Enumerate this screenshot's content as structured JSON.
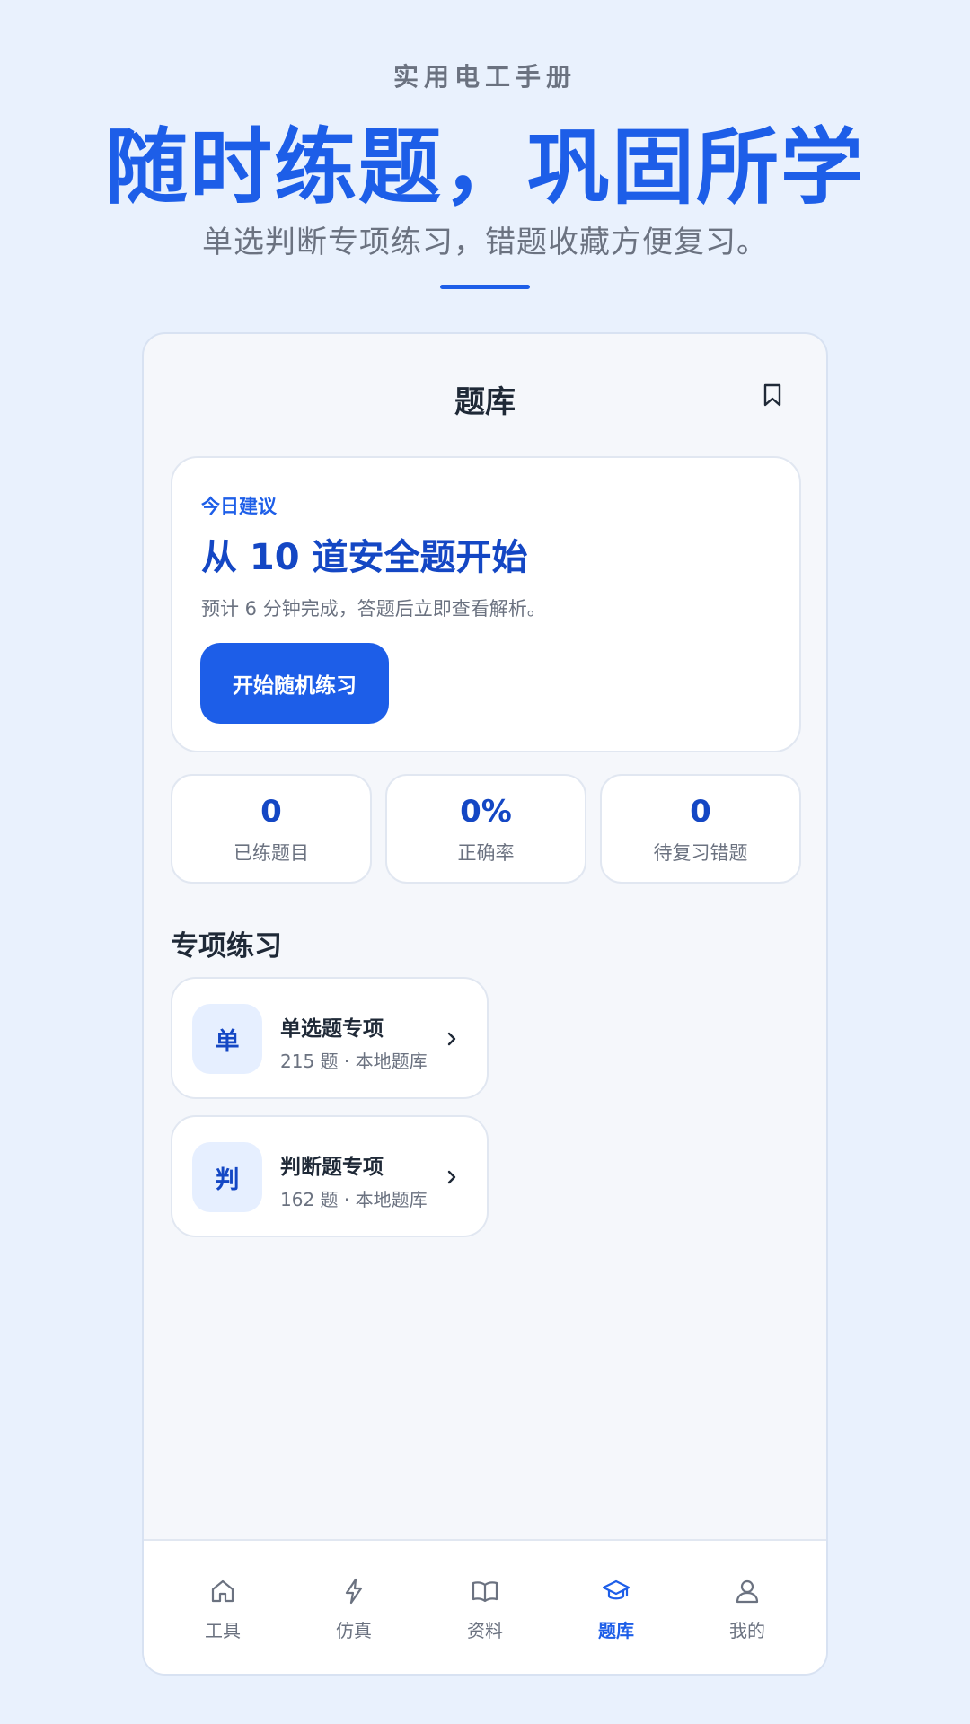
{
  "promo": {
    "app_name": "实用电工手册",
    "headline": "随时练题，巩固所学",
    "subhead": "单选判断专项练习，错题收藏方便复习。"
  },
  "topbar": {
    "title": "题库",
    "bookmark_icon": "bookmark-icon"
  },
  "suggestion": {
    "tag": "今日建议",
    "title": "从 10 道安全题开始",
    "description": "预计 6 分钟完成，答题后立即查看解析。",
    "button_label": "开始随机练习"
  },
  "stats": [
    {
      "value": "0",
      "label": "已练题目"
    },
    {
      "value": "0%",
      "label": "正确率"
    },
    {
      "value": "0",
      "label": "待复习错题"
    }
  ],
  "section": {
    "title": "专项练习"
  },
  "practice": [
    {
      "badge": "单",
      "name": "单选题专项",
      "meta": "215 题 · 本地题库"
    },
    {
      "badge": "判",
      "name": "判断题专项",
      "meta": "162 题 · 本地题库"
    }
  ],
  "nav": {
    "items": [
      {
        "label": "工具",
        "icon": "home-icon"
      },
      {
        "label": "仿真",
        "icon": "lightning-icon"
      },
      {
        "label": "资料",
        "icon": "book-icon"
      },
      {
        "label": "题库",
        "icon": "graduation-cap-icon"
      },
      {
        "label": "我的",
        "icon": "user-icon"
      }
    ],
    "active": "题库"
  },
  "colors": {
    "accent": "#1d5ee8",
    "accent_dark": "#1447c4",
    "background": "#e9f1fd",
    "muted_text": "#6b7280"
  }
}
